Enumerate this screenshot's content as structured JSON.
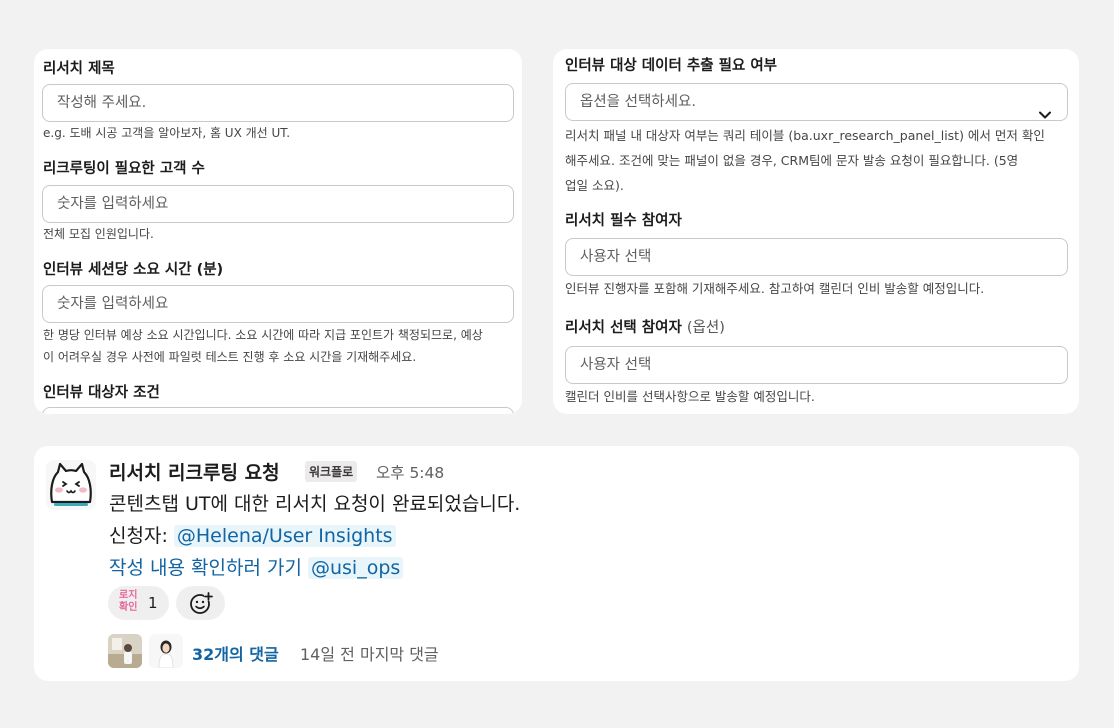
{
  "form_left": {
    "fields": [
      {
        "label": "리서치 제목",
        "value": "작성해 주세요.",
        "help": "e.g. 도배 시공 고객을 알아보자, 홈 UX 개선 UT."
      },
      {
        "label": "리크루팅이 필요한 고객 수",
        "value": "숫자를 입력하세요",
        "help": "전체 모집 인원입니다."
      },
      {
        "label": "인터뷰 세션당 소요 시간 (분)",
        "value": "숫자를 입력하세요",
        "help_line1": "한 명당 인터뷰 예상 소요 시간입니다. 소요 시간에 따라 지급 포인트가 책정되므로, 예상",
        "help_line2": "이 어려우실 경우 사전에 파일럿 테스트 진행 후 소요 시간을 기재해주세요."
      },
      {
        "label": "인터뷰 대상자 조건"
      }
    ]
  },
  "form_right": {
    "data_extract": {
      "label": "인터뷰 대상 데이터 추출 필요 여부",
      "value": "옵션을 선택하세요.",
      "help_line1": "리서치 패널 내 대상자 여부는 쿼리 테이블 (ba.uxr_research_panel_list) 에서 먼저 확인",
      "help_line2": "해주세요. 조건에 맞는 패널이 없을 경우, CRM팀에 문자 발송 요청이 필요합니다. (5영",
      "help_line3": "업일 소요)."
    },
    "required_participants": {
      "label": "리서치 필수 참여자",
      "value": "사용자 선택",
      "help": "인터뷰 진행자를 포함해 기재해주세요. 참고하여 캘린더 인비 발송할 예정입니다."
    },
    "optional_participants": {
      "label": "리서치 선택 참여자",
      "label_suffix": "(옵션)",
      "value": "사용자 선택",
      "help": "캘린더 인비를 선택사항으로 발송할 예정입니다."
    }
  },
  "message": {
    "sender": "리서치 리크루팅 요청",
    "badge": "워크플로",
    "time": "오후 5:48",
    "line1": "콘텐츠탭 UT에 대한 리서치 요청이 완료되었습니다.",
    "requester_label": "신청자:",
    "requester_mention": "@Helena/User Insights",
    "link_text": "작성 내용 확인하러 가기",
    "ops_mention": "@usi_ops",
    "reaction": {
      "emoji_line1": "로지",
      "emoji_line2": "확인",
      "count": "1"
    },
    "thread": {
      "replies": "32개의 댓글",
      "last_reply": "14일 전 마지막 댓글"
    }
  }
}
